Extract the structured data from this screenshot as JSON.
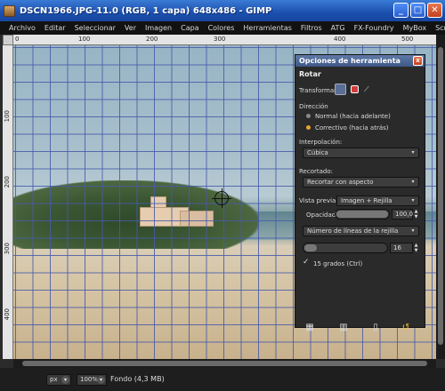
{
  "window": {
    "title": "DSCN1966.JPG-11.0 (RGB, 1 capa) 648x486 - GIMP",
    "minimize": "_",
    "maximize": "□",
    "close": "✕"
  },
  "menu": [
    "Archivo",
    "Editar",
    "Seleccionar",
    "Ver",
    "Imagen",
    "Capa",
    "Colores",
    "Herramientas",
    "Filtros",
    "ATG",
    "FX-Foundry",
    "MyBox",
    "Scrip"
  ],
  "ruler_top": [
    "0",
    "100",
    "200",
    "300",
    "400",
    "500"
  ],
  "ruler_left": [
    "100",
    "200",
    "300",
    "400"
  ],
  "status": {
    "unit": "px",
    "zoom": "100%",
    "info": "Fondo (4,3 MB)"
  },
  "tool_options": {
    "title": "Opciones de herramienta",
    "close": "x",
    "tool_name": "Rotar",
    "transform_label": "Transformar:",
    "direction_label": "Dirección",
    "direction_normal": "Normal (hacia adelante)",
    "direction_corrective": "Correctivo (hacia atrás)",
    "interpolation_label": "Interpolación:",
    "interpolation_value": "Cúbica",
    "clipping_label": "Recortado:",
    "clipping_value": "Recortar con aspecto",
    "preview_label": "Vista previa:",
    "preview_value": "Imagen + Rejilla",
    "opacity_label": "Opacidad:",
    "opacity_value": "100,0",
    "opacity_percent": 100,
    "guides_value": "Número de líneas de la rejilla",
    "guides_count": "16",
    "constrain_label": "15 grados  (Ctrl)",
    "constrain_checked": "✓"
  },
  "colors": {
    "accent_orange": "#e7a331",
    "titlebar_blue": "#1c4fae",
    "grid_blue": "#4658aa"
  }
}
